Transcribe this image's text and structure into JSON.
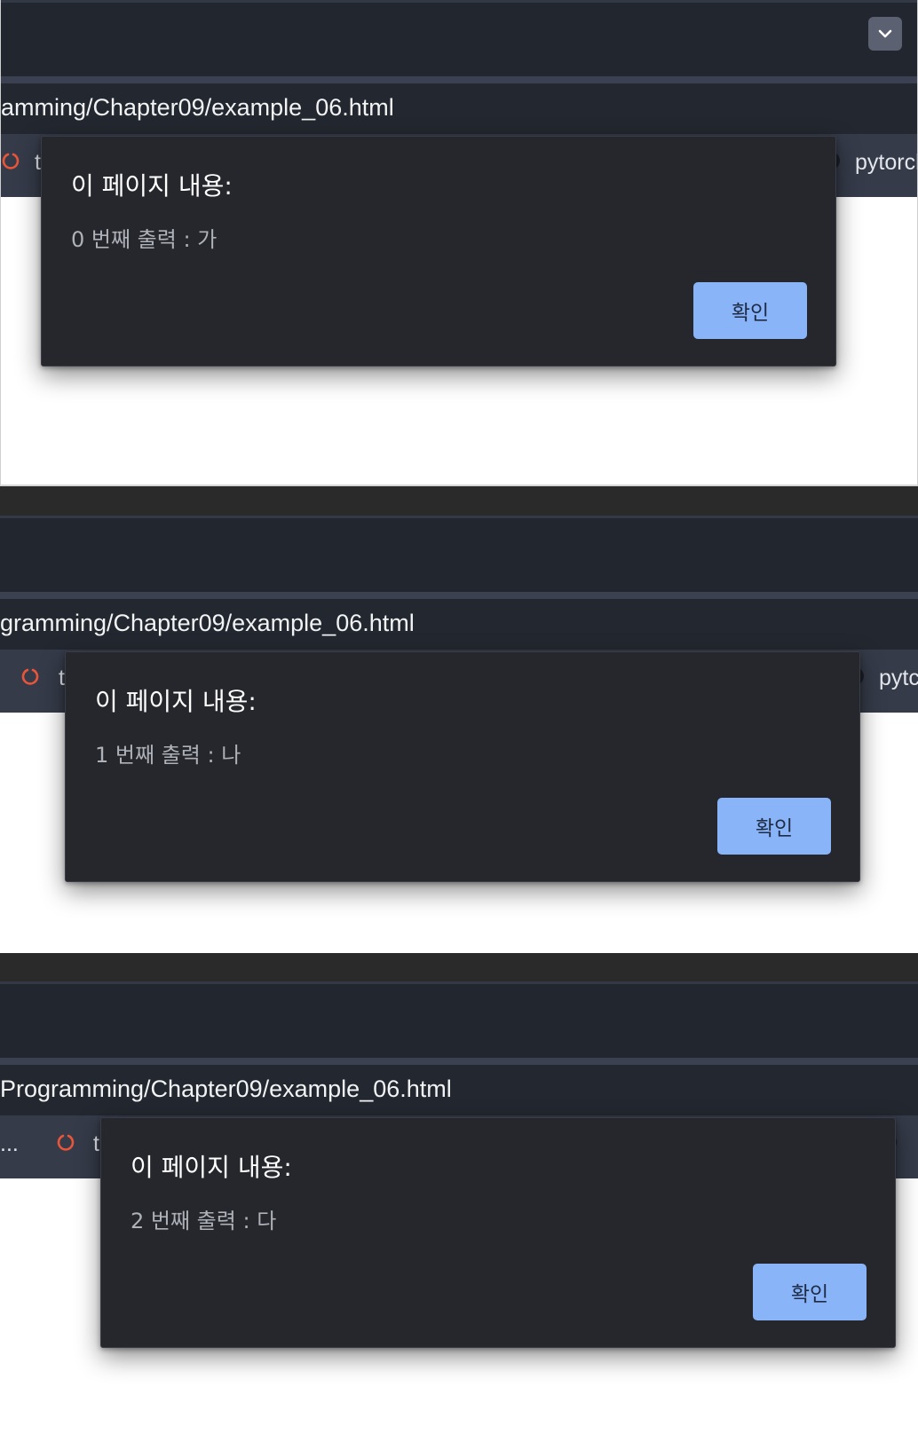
{
  "screens": [
    {
      "url": "amming/Chapter09/example_06.html",
      "bookmark_left_text": "t",
      "bookmark_right_text": "pytorcl",
      "dialog": {
        "title": "이 페이지 내용:",
        "message": "0 번째 출력 : 가",
        "ok_label": "확인"
      }
    },
    {
      "url": "gramming/Chapter09/example_06.html",
      "bookmark_left_text": "t",
      "bookmark_right_text": "pytc",
      "dialog": {
        "title": "이 페이지 내용:",
        "message": "1 번째 출력 : 나",
        "ok_label": "확인"
      }
    },
    {
      "url": "Programming/Chapter09/example_06.html",
      "bookmark_prefix_text": "...",
      "bookmark_left_text": "t",
      "dialog": {
        "title": "이 페이지 내용:",
        "message": "2 번째 출력 : 다",
        "ok_label": "확인"
      }
    }
  ],
  "colors": {
    "dialog_bg": "#25272d",
    "button_bg": "#8ab4f8",
    "toolbar_bg": "#22272f",
    "bookmark_bar_bg": "#353b49",
    "icon_accent": "#e8553a"
  },
  "icons": {
    "tab_menu": "chevron-down-icon",
    "bookmark": "power-ring-icon"
  }
}
